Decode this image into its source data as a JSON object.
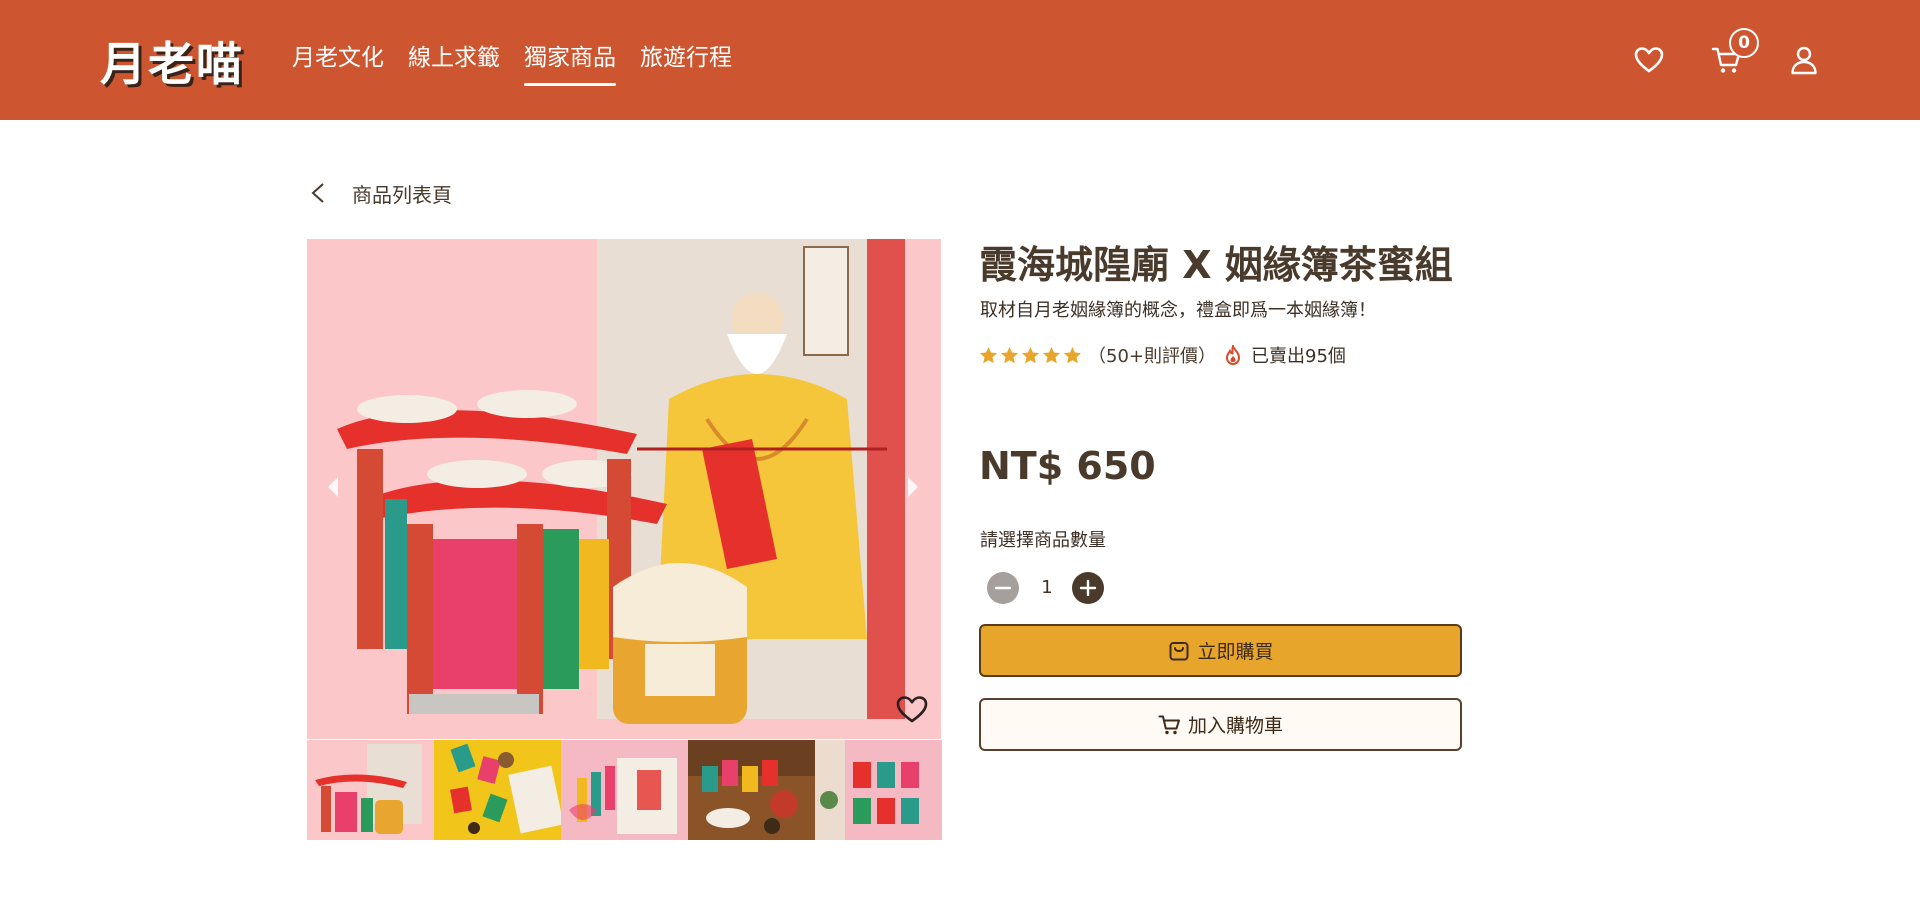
{
  "header": {
    "logo": "月老喵",
    "nav": [
      {
        "label": "月老文化"
      },
      {
        "label": "線上求籤"
      },
      {
        "label": "獨家商品"
      },
      {
        "label": "旅遊行程"
      }
    ],
    "active_nav_index": 2,
    "cart_count": "0",
    "icons": [
      "heart-icon",
      "cart-icon",
      "user-icon"
    ],
    "colors": {
      "bar": "#cd5630",
      "text": "#ffffff"
    }
  },
  "breadcrumb": {
    "back_label": "商品列表頁"
  },
  "gallery": {
    "thumbnail_count": 5,
    "selected_thumbnail": 0
  },
  "product": {
    "title": "霞海城隍廟 X 姻緣簿茶蜜組",
    "subtitle": "取材自月老姻緣簿的概念，禮盒即爲一本姻緣簿！",
    "rating": 5,
    "reviews": "（50+則評價）",
    "sold": "已賣出95個",
    "price": "NT$ 650",
    "quantity_label": "請選擇商品數量",
    "quantity": "1",
    "buy_now_label": "立即購買",
    "add_to_cart_label": "加入購物車"
  },
  "colors": {
    "accent": "#e8a52b",
    "brand": "#cd5630",
    "text": "#4a3a2c",
    "star": "#e8a52b",
    "image_bg": "#fcc7c9"
  }
}
